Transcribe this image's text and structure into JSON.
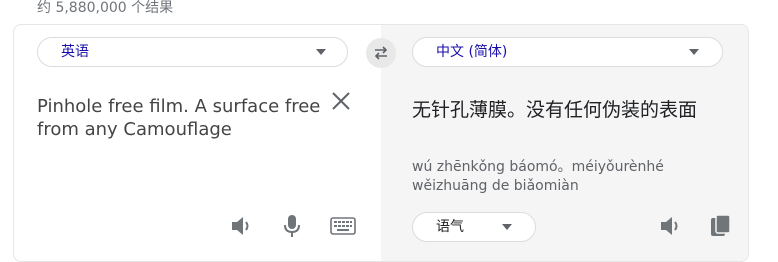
{
  "results_count": "约 5,880,000 个结果",
  "source": {
    "language": "英语",
    "text": "Pinhole free film. A surface free from any Camouflage",
    "icons": [
      "speaker-icon",
      "microphone-icon",
      "keyboard-icon",
      "close-icon"
    ]
  },
  "target": {
    "language": "中文 (简体)",
    "text": "无针孔薄膜。没有任何伪装的表面",
    "romanization": "wú zhēnkǒng báomó。méiyǒurènhé wěizhuāng de biǎomiàn",
    "tone_option": "语气",
    "icons": [
      "speaker-icon",
      "copy-icon"
    ]
  },
  "swap_icon": "swap-icon",
  "colors": {
    "language_link": "#1a0dab",
    "target_panel_bg": "#f5f5f5",
    "icon_gray": "#70757a"
  }
}
